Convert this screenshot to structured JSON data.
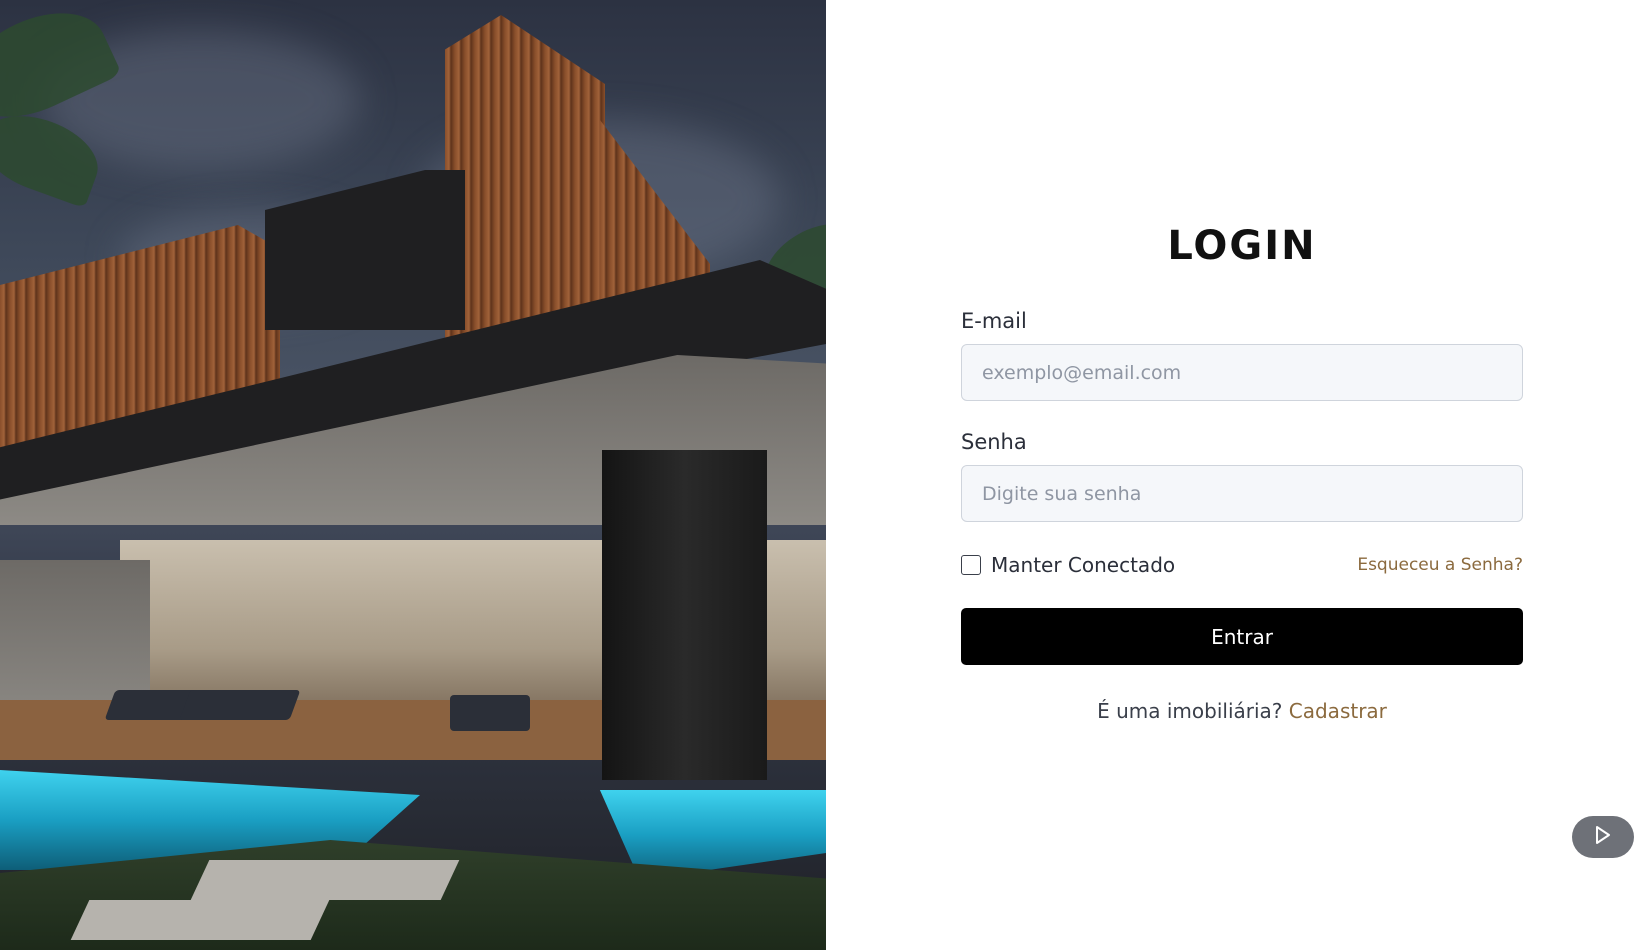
{
  "hero": {
    "image_description_icon": "house-photo"
  },
  "login": {
    "title": "LOGIN",
    "email": {
      "label": "E-mail",
      "placeholder": "exemplo@email.com",
      "value": ""
    },
    "password": {
      "label": "Senha",
      "placeholder": "Digite sua senha",
      "value": ""
    },
    "remember": {
      "label": "Manter Conectado",
      "checked": false
    },
    "forgot_label": "Esqueceu a Senha?",
    "submit_label": "Entrar",
    "register_prompt": "É uma imobiliária?",
    "register_label": "Cadastrar"
  },
  "floating": {
    "play_icon": "play-icon"
  },
  "colors": {
    "accent": "#8b6a3e",
    "button_bg": "#000000",
    "input_bg": "#f5f7fa",
    "input_border": "#cfd4dc"
  }
}
